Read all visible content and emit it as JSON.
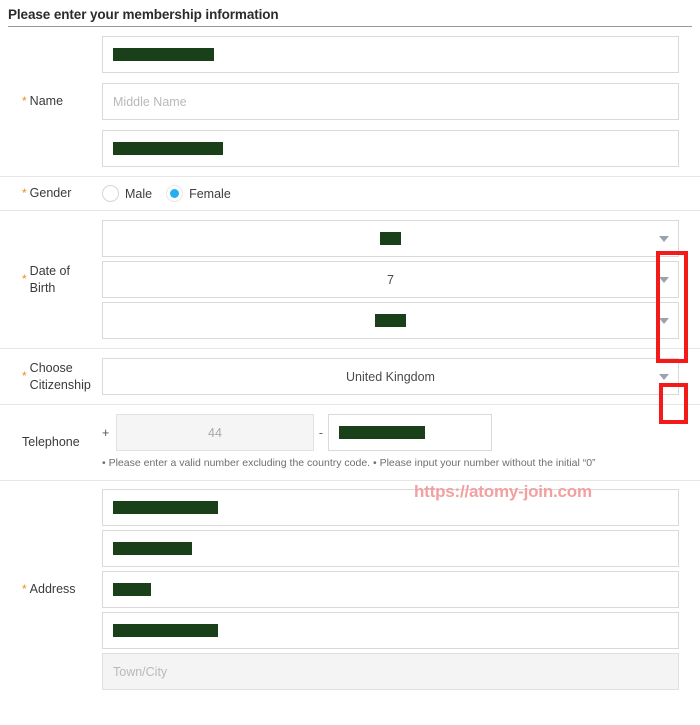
{
  "header": {
    "title": "Please enter your membership information"
  },
  "form": {
    "name": {
      "label": "Name",
      "required": true,
      "first_name": {
        "value": "",
        "redacted": true,
        "redact_width": 101
      },
      "middle_name": {
        "value": "",
        "placeholder": "Middle Name",
        "redacted": false
      },
      "last_name": {
        "value": "",
        "redacted": true,
        "redact_width": 110
      }
    },
    "gender": {
      "label": "Gender",
      "required": true,
      "options": [
        {
          "label": "Male",
          "selected": false
        },
        {
          "label": "Female",
          "selected": true
        }
      ],
      "selected_value": "Female",
      "selected_color": "#22b0ee"
    },
    "date_of_birth": {
      "label": "Date of Birth",
      "required": true,
      "month": {
        "value": "",
        "redacted": true,
        "redact_width": 21
      },
      "day": {
        "value": "7",
        "redacted": false
      },
      "year": {
        "value": "",
        "redacted": true,
        "redact_width": 31
      }
    },
    "citizenship": {
      "label": "Choose Citizenship",
      "required": true,
      "value": "United Kingdom"
    },
    "telephone": {
      "label": "Telephone",
      "required": false,
      "plus_symbol": "+",
      "country_code": "44",
      "country_code_disabled": true,
      "separator": "-",
      "number": {
        "value": "",
        "redacted": true,
        "redact_width": 86
      },
      "hint": "• Please enter a valid number excluding the country code. • Please input your number without the initial “0”"
    },
    "address": {
      "label": "Address",
      "required": true,
      "lines": [
        {
          "value": "",
          "redacted": true,
          "redact_width": 105,
          "placeholder": ""
        },
        {
          "value": "",
          "redacted": true,
          "redact_width": 79,
          "placeholder": ""
        },
        {
          "value": "",
          "redacted": true,
          "redact_width": 38,
          "placeholder": ""
        },
        {
          "value": "",
          "redacted": true,
          "redact_width": 105,
          "placeholder": ""
        },
        {
          "value": "",
          "redacted": false,
          "placeholder": "Town/City",
          "disabled": true
        }
      ]
    }
  },
  "annotations": {
    "dob_highlight": {
      "color": "#f41a1a",
      "shape": "rectangle"
    },
    "citizenship_highlight": {
      "color": "#f41a1a",
      "shape": "rectangle"
    }
  },
  "watermark": {
    "text": "https://atomy-join.com",
    "color": "#f2a0a0"
  }
}
